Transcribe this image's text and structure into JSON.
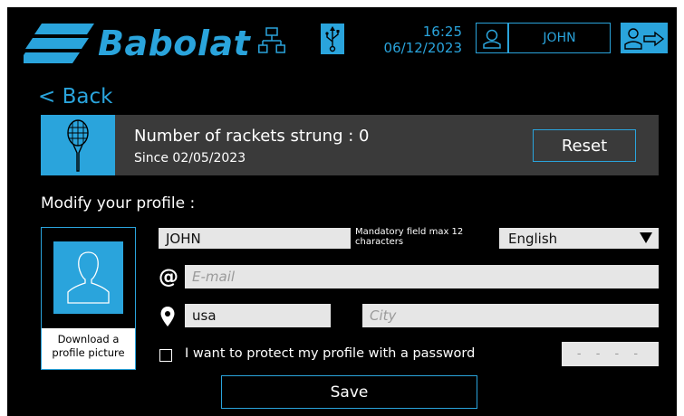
{
  "brand": {
    "logo_text": "Babolat",
    "accent": "#2aa4dc"
  },
  "header": {
    "time": "16:25",
    "date": "06/12/2023",
    "user_name": "JOHN",
    "icons": [
      "network-icon",
      "usb-icon",
      "user-icon",
      "logout-icon"
    ]
  },
  "nav": {
    "back_label": "< Back"
  },
  "stats": {
    "rackets_strung_text": "Number of rackets strung : 0",
    "since_text": "Since 02/05/2023",
    "reset_label": "Reset",
    "icon": "racket-icon"
  },
  "profile": {
    "section_title": "Modify your profile :",
    "picture_label_line1": "Download a",
    "picture_label_line2": "profile picture",
    "name_value": "JOHN",
    "name_hint": "Mandatory field max 12 characters",
    "language_value": "English",
    "email_placeholder": "E-mail",
    "country_value": "usa",
    "city_placeholder": "City",
    "password_checkbox_label": "I want to protect my profile with a password",
    "password_mask": "- - - -",
    "save_label": "Save"
  }
}
